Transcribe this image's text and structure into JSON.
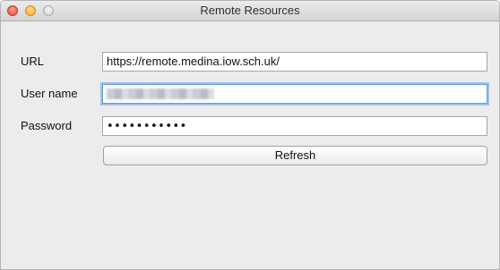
{
  "window": {
    "title": "Remote Resources"
  },
  "form": {
    "url_label": "URL",
    "url_value": "https://remote.medina.iow.sch.uk/",
    "username_label": "User name",
    "password_label": "Password",
    "password_masked": "•••••••••••",
    "refresh_label": "Refresh"
  }
}
